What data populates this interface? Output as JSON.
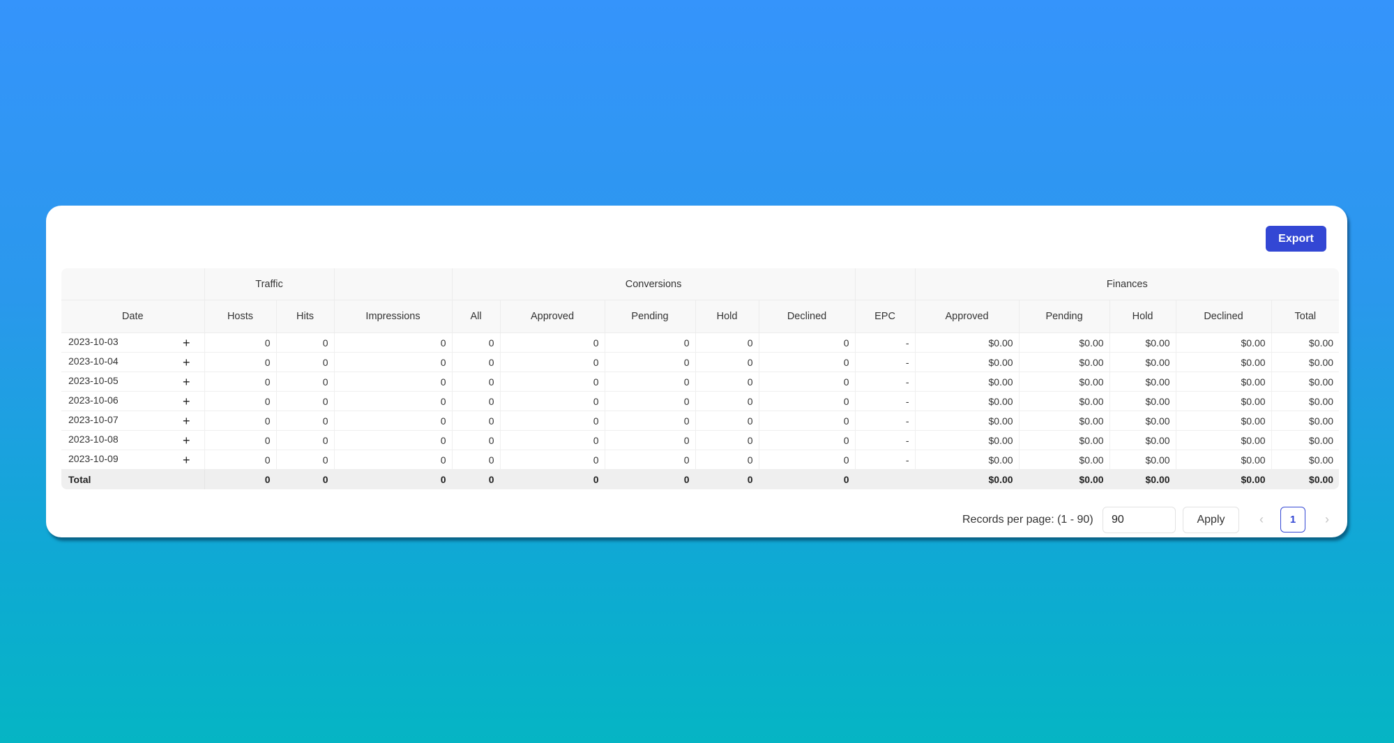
{
  "toolbar": {
    "export_label": "Export"
  },
  "table": {
    "group_headers": {
      "traffic": "Traffic",
      "conversions": "Conversions",
      "finances": "Finances"
    },
    "columns": {
      "date": "Date",
      "hosts": "Hosts",
      "hits": "Hits",
      "impressions": "Impressions",
      "conv_all": "All",
      "conv_approved": "Approved",
      "conv_pending": "Pending",
      "conv_hold": "Hold",
      "conv_declined": "Declined",
      "epc": "EPC",
      "fin_approved": "Approved",
      "fin_pending": "Pending",
      "fin_hold": "Hold",
      "fin_declined": "Declined",
      "fin_total": "Total"
    },
    "expand_icon": "plus-icon",
    "rows": [
      {
        "date": "2023-10-03",
        "hosts": "0",
        "hits": "0",
        "impressions": "0",
        "conv_all": "0",
        "conv_approved": "0",
        "conv_pending": "0",
        "conv_hold": "0",
        "conv_declined": "0",
        "epc": "-",
        "fin_approved": "$0.00",
        "fin_pending": "$0.00",
        "fin_hold": "$0.00",
        "fin_declined": "$0.00",
        "fin_total": "$0.00"
      },
      {
        "date": "2023-10-04",
        "hosts": "0",
        "hits": "0",
        "impressions": "0",
        "conv_all": "0",
        "conv_approved": "0",
        "conv_pending": "0",
        "conv_hold": "0",
        "conv_declined": "0",
        "epc": "-",
        "fin_approved": "$0.00",
        "fin_pending": "$0.00",
        "fin_hold": "$0.00",
        "fin_declined": "$0.00",
        "fin_total": "$0.00"
      },
      {
        "date": "2023-10-05",
        "hosts": "0",
        "hits": "0",
        "impressions": "0",
        "conv_all": "0",
        "conv_approved": "0",
        "conv_pending": "0",
        "conv_hold": "0",
        "conv_declined": "0",
        "epc": "-",
        "fin_approved": "$0.00",
        "fin_pending": "$0.00",
        "fin_hold": "$0.00",
        "fin_declined": "$0.00",
        "fin_total": "$0.00"
      },
      {
        "date": "2023-10-06",
        "hosts": "0",
        "hits": "0",
        "impressions": "0",
        "conv_all": "0",
        "conv_approved": "0",
        "conv_pending": "0",
        "conv_hold": "0",
        "conv_declined": "0",
        "epc": "-",
        "fin_approved": "$0.00",
        "fin_pending": "$0.00",
        "fin_hold": "$0.00",
        "fin_declined": "$0.00",
        "fin_total": "$0.00"
      },
      {
        "date": "2023-10-07",
        "hosts": "0",
        "hits": "0",
        "impressions": "0",
        "conv_all": "0",
        "conv_approved": "0",
        "conv_pending": "0",
        "conv_hold": "0",
        "conv_declined": "0",
        "epc": "-",
        "fin_approved": "$0.00",
        "fin_pending": "$0.00",
        "fin_hold": "$0.00",
        "fin_declined": "$0.00",
        "fin_total": "$0.00"
      },
      {
        "date": "2023-10-08",
        "hosts": "0",
        "hits": "0",
        "impressions": "0",
        "conv_all": "0",
        "conv_approved": "0",
        "conv_pending": "0",
        "conv_hold": "0",
        "conv_declined": "0",
        "epc": "-",
        "fin_approved": "$0.00",
        "fin_pending": "$0.00",
        "fin_hold": "$0.00",
        "fin_declined": "$0.00",
        "fin_total": "$0.00"
      },
      {
        "date": "2023-10-09",
        "hosts": "0",
        "hits": "0",
        "impressions": "0",
        "conv_all": "0",
        "conv_approved": "0",
        "conv_pending": "0",
        "conv_hold": "0",
        "conv_declined": "0",
        "epc": "-",
        "fin_approved": "$0.00",
        "fin_pending": "$0.00",
        "fin_hold": "$0.00",
        "fin_declined": "$0.00",
        "fin_total": "$0.00"
      }
    ],
    "total": {
      "date": "Total",
      "hosts": "0",
      "hits": "0",
      "impressions": "0",
      "conv_all": "0",
      "conv_approved": "0",
      "conv_pending": "0",
      "conv_hold": "0",
      "conv_declined": "0",
      "epc": "",
      "fin_approved": "$0.00",
      "fin_pending": "$0.00",
      "fin_hold": "$0.00",
      "fin_declined": "$0.00",
      "fin_total": "$0.00"
    }
  },
  "pagination": {
    "records_label": "Records per page: (1 - 90)",
    "records_value": "90",
    "apply_label": "Apply",
    "prev_icon": "chevron-left-icon",
    "next_icon": "chevron-right-icon",
    "current_page": "1"
  },
  "colors": {
    "accent": "#3347d4",
    "bg_top": "#3594fb",
    "bg_bottom": "#05b5c4"
  }
}
